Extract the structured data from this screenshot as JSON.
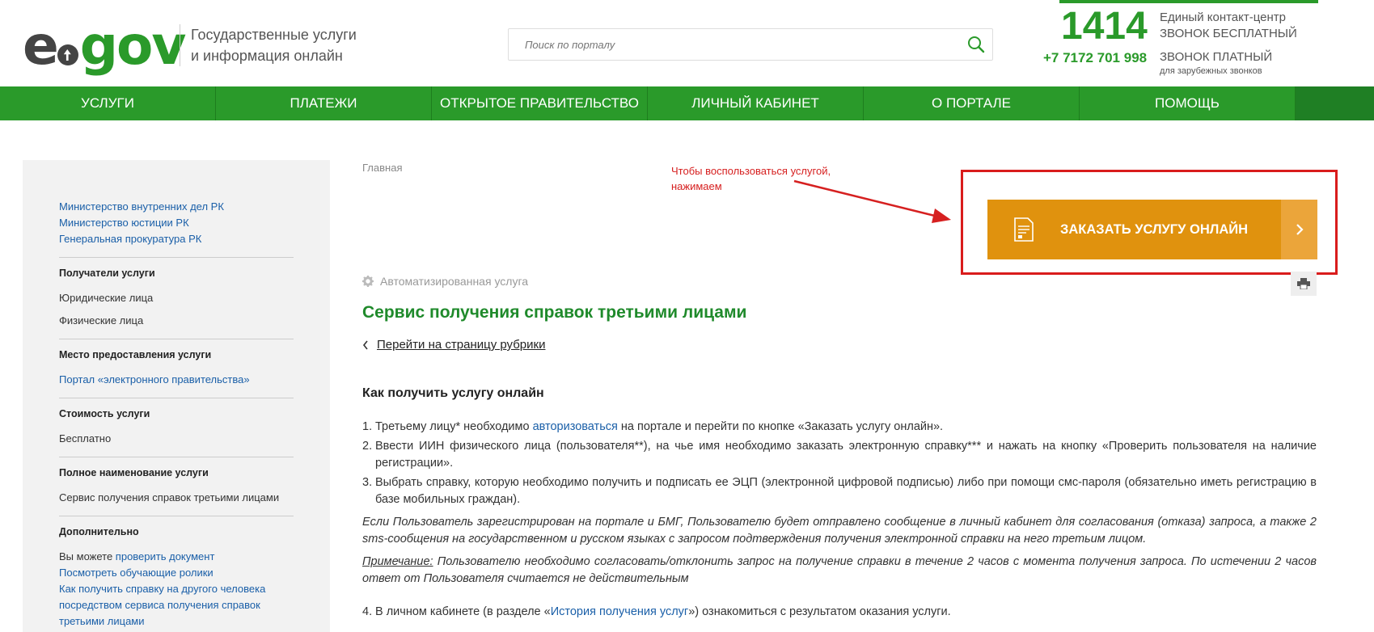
{
  "header": {
    "logo_e": "e",
    "logo_gov": "gov",
    "tagline_line1": "Государственные услуги",
    "tagline_line2": "и информация онлайн",
    "search_placeholder": "Поиск по порталу",
    "contact": {
      "short_number": "1414",
      "short_desc_line1": "Единый контакт-центр",
      "short_desc_line2": "ЗВОНОК БЕСПЛАТНЫЙ",
      "phone": "+7 7172 701 998",
      "paid_label": "ЗВОНОК ПЛАТНЫЙ",
      "paid_note": "для зарубежных звонков"
    }
  },
  "nav": [
    "Услуги",
    "Платежи",
    "Открытое правительство",
    "Личный кабинет",
    "О портале",
    "Помощь"
  ],
  "sidebar": {
    "agencies": [
      "Министерство внутренних дел РК",
      "Министерство юстиции РК",
      "Генеральная прокуратура РК"
    ],
    "recipients_heading": "Получатели услуги",
    "recipients": [
      "Юридические лица",
      "Физические лица"
    ],
    "place_heading": "Место предоставления услуги",
    "place_value": "Портал «электронного правительства»",
    "cost_heading": "Стоимость услуги",
    "cost_value": "Бесплатно",
    "fullname_heading": "Полное наименование услуги",
    "fullname_value": "Сервис получения справок третьими лицами",
    "extra_heading": "Дополнительно",
    "extra_prefix": "Вы можете ",
    "extra_check_link": "проверить документ",
    "extra_videos_link": "Посмотреть обучающие ролики",
    "extra_howto_link": "Как получить справку на другого человека посредством сервиса получения справок третьими лицами"
  },
  "main": {
    "breadcrumb": "Главная",
    "annotation_line1": "Чтобы воспользоваться услугой,",
    "annotation_line2": "нажимаем",
    "order_button": "Заказать услугу онлайн",
    "auto_service": "Автоматизированная услуга",
    "title": "Сервис получения справок третьими лицами",
    "back_link": "Перейти на страницу рубрики",
    "how_title": "Как получить услугу онлайн",
    "step1_a": "Третьему лицу* необходимо ",
    "step1_link": "авторизоваться",
    "step1_b": " на портале и перейти по кнопке «Заказать услугу онлайн».",
    "step2": "Ввести ИИН физического лица (пользователя**), на чье имя необходимо заказать электронную справку*** и нажать на кнопку «Проверить пользователя на наличие регистрации».",
    "step3": "Выбрать справку, которую необходимо получить и подписать ее ЭЦП (электронной цифровой подписью) либо при помощи смс-пароля (обязательно иметь регистрацию в базе мобильных граждан).",
    "note1": "Если Пользователь зарегистрирован на портале и БМГ, Пользователю будет отправлено сообщение в личный кабинет для согласования (отказа) запроса, а также 2 sms-сообщения на государственном и русском языках с запросом подтверждения получения электронной справки на него третьим лицом.",
    "note2_label": "Примечание:",
    "note2": " Пользователю необходимо согласовать/отклонить запрос на получение справки в течение 2 часов с момента получения запроса. По истечении 2 часов ответ от Пользователя считается не действительным",
    "step4_a": "В личном кабинете (в разделе «",
    "step4_link": "История получения услуг",
    "step4_b": "») ознакомиться с результатом оказания услуги."
  },
  "colors": {
    "brand_green": "#2a9a2a",
    "order_orange": "#e0920e",
    "annotation_red": "#d62020"
  }
}
